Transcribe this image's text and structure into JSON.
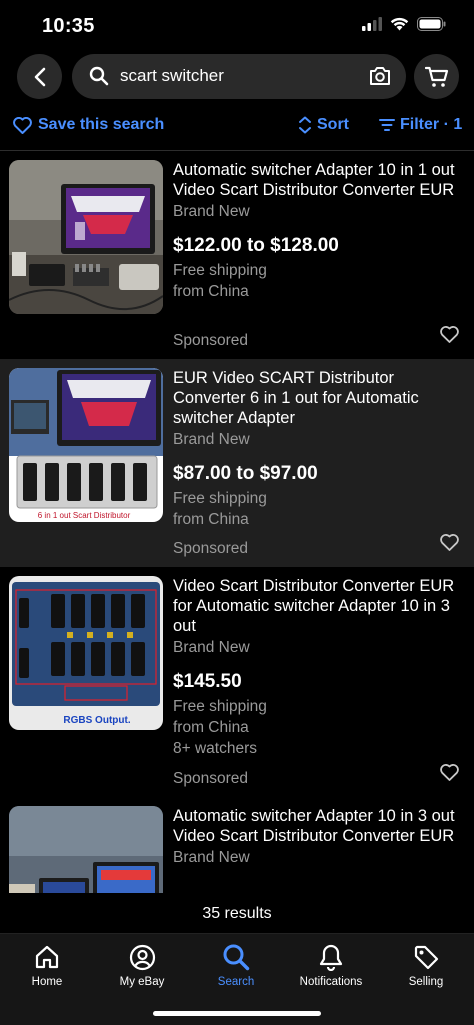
{
  "status_bar": {
    "time": "10:35"
  },
  "search": {
    "query": "scart switcher"
  },
  "actions": {
    "save_search": "Save this search",
    "sort": "Sort",
    "filter": "Filter · 1"
  },
  "listings": [
    {
      "title": "Automatic switcher Adapter 10 in 1 out  Video Scart Distributor Converter EUR",
      "condition": "Brand New",
      "price": "$122.00 to $128.00",
      "shipping": "Free shipping",
      "origin": "from China",
      "sponsored": "Sponsored"
    },
    {
      "title": "EUR Video SCART Distributor Converter 6 in 1 out for Automatic switcher Adapter",
      "condition": "Brand New",
      "price": "$87.00 to $97.00",
      "shipping": "Free shipping",
      "origin": "from China",
      "sponsored": "Sponsored",
      "image_caption": "6 in 1 out Scart Distributor"
    },
    {
      "title": "Video Scart Distributor Converter EUR for Automatic switcher Adapter 10 in 3 out",
      "condition": "Brand New",
      "price": "$145.50",
      "shipping": "Free shipping",
      "origin": "from China",
      "watchers": "8+ watchers",
      "sponsored": "Sponsored",
      "image_caption": "RGBS Output."
    },
    {
      "title": "Automatic switcher Adapter 10 in 3 out  Video Scart Distributor Converter EUR",
      "condition": "Brand New"
    }
  ],
  "results": "35 results",
  "nav": {
    "home": "Home",
    "my_ebay": "My eBay",
    "search": "Search",
    "notifications": "Notifications",
    "selling": "Selling"
  },
  "colors": {
    "accent": "#4a8fff",
    "background": "#000000",
    "alt_row": "#1f1f1f",
    "muted_text": "#9a9a9a"
  }
}
